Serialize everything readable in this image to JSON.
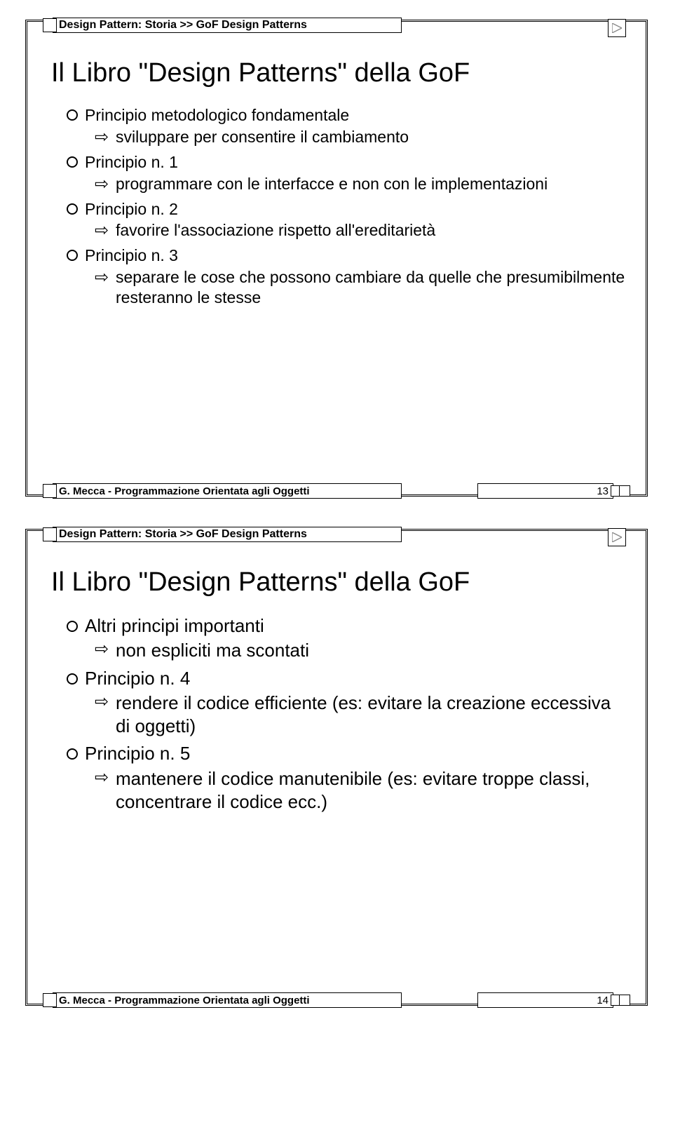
{
  "slide1": {
    "breadcrumb": "Design Pattern: Storia >> GoF Design Patterns",
    "title": "Il Libro \"Design Patterns\" della GoF",
    "items": [
      {
        "l1": "Principio metodologico fondamentale",
        "l2": "sviluppare per consentire il cambiamento"
      },
      {
        "l1": "Principio n. 1",
        "l2": "programmare con le interfacce e non con le implementazioni"
      },
      {
        "l1": "Principio n. 2",
        "l2": "favorire l'associazione rispetto all'ereditarietà"
      },
      {
        "l1": "Principio n. 3",
        "l2": "separare le cose che possono cambiare da quelle che presumibilmente resteranno le stesse"
      }
    ],
    "footer": "G. Mecca - Programmazione Orientata agli Oggetti",
    "page": "13"
  },
  "slide2": {
    "breadcrumb": "Design Pattern: Storia >> GoF Design Patterns",
    "title": "Il Libro \"Design Patterns\" della GoF",
    "items": [
      {
        "l1": "Altri principi importanti",
        "l2": "non espliciti ma scontati"
      },
      {
        "l1": "Principio n. 4",
        "l2": "rendere il codice efficiente (es: evitare la creazione eccessiva di oggetti)"
      },
      {
        "l1": "Principio n. 5",
        "l2": "mantenere il codice manutenibile (es: evitare troppe classi, concentrare il codice ecc.)"
      }
    ],
    "footer": "G. Mecca - Programmazione Orientata agli Oggetti",
    "page": "14"
  }
}
